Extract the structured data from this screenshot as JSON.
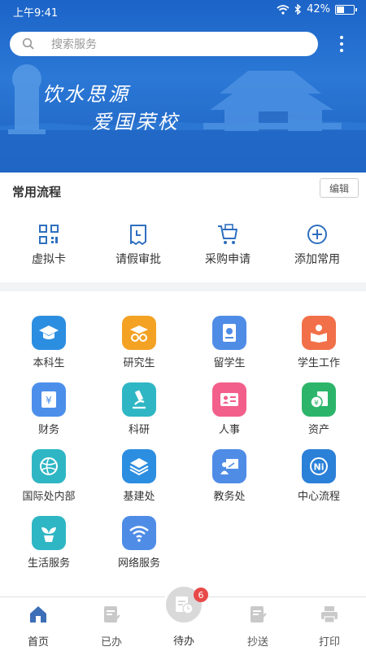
{
  "status": {
    "time": "上午9:41",
    "battery": "42%"
  },
  "search": {
    "placeholder": "搜索服务"
  },
  "banner": {
    "motto_line1": "饮水思源",
    "motto_line2": "爱国荣校"
  },
  "common": {
    "title": "常用流程",
    "edit_label": "编辑",
    "items": [
      {
        "label": "虚拟卡",
        "icon": "qr-code-icon"
      },
      {
        "label": "请假审批",
        "icon": "leave-request-icon"
      },
      {
        "label": "采购申请",
        "icon": "shopping-cart-icon"
      },
      {
        "label": "添加常用",
        "icon": "add-circle-icon"
      }
    ]
  },
  "apps": [
    {
      "label": "本科生",
      "icon": "graduation-cap-icon",
      "color": "#2c8ee0"
    },
    {
      "label": "研究生",
      "icon": "grad-student-icon",
      "color": "#f3a224"
    },
    {
      "label": "留学生",
      "icon": "passport-icon",
      "color": "#4f8ce6"
    },
    {
      "label": "学生工作",
      "icon": "student-work-icon",
      "color": "#f27049"
    },
    {
      "label": "财务",
      "icon": "finance-icon",
      "color": "#4c8fea"
    },
    {
      "label": "科研",
      "icon": "microscope-icon",
      "color": "#2fb6c4"
    },
    {
      "label": "人事",
      "icon": "id-card-icon",
      "color": "#f25f8a"
    },
    {
      "label": "资产",
      "icon": "asset-icon",
      "color": "#2cb56a"
    },
    {
      "label": "国际处内部",
      "icon": "globe-icon",
      "color": "#2fb6c4"
    },
    {
      "label": "基建处",
      "icon": "layers-icon",
      "color": "#2c8ee0"
    },
    {
      "label": "教务处",
      "icon": "teaching-icon",
      "color": "#4f8ce6"
    },
    {
      "label": "中心流程",
      "icon": "center-flow-icon",
      "color": "#2b80d8"
    },
    {
      "label": "生活服务",
      "icon": "plant-icon",
      "color": "#2fb6c4"
    },
    {
      "label": "网络服务",
      "icon": "wifi-icon",
      "color": "#4f8ce6"
    }
  ],
  "tabs": [
    {
      "label": "首页",
      "icon": "home-icon"
    },
    {
      "label": "已办",
      "icon": "done-icon"
    },
    {
      "label": "待办",
      "icon": "pending-icon",
      "badge": "6"
    },
    {
      "label": "抄送",
      "icon": "cc-icon"
    },
    {
      "label": "打印",
      "icon": "printer-icon"
    }
  ]
}
